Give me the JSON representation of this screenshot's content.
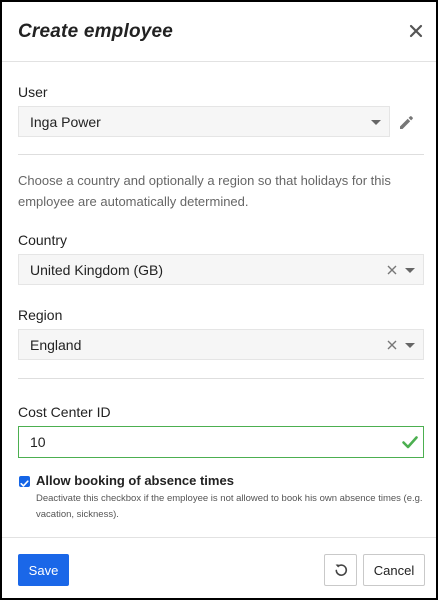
{
  "dialog": {
    "title": "Create employee",
    "close_icon": "close-icon"
  },
  "user": {
    "label": "User",
    "value": "Inga Power",
    "edit_icon": "pencil-icon"
  },
  "hint": "Choose a country and optionally a region so that holidays for this employee are automatically determined.",
  "country": {
    "label": "Country",
    "value": "United Kingdom (GB)"
  },
  "region": {
    "label": "Region",
    "value": "England"
  },
  "cost_center": {
    "label": "Cost Center ID",
    "value": "10",
    "valid_icon": "checkmark-icon"
  },
  "absence": {
    "checked": true,
    "label": "Allow booking of absence times",
    "help": "Deactivate this checkbox if the employee is not allowed to book his own absence times (e.g. vacation, sickness)."
  },
  "footer": {
    "save_label": "Save",
    "reset_icon": "undo-icon",
    "cancel_label": "Cancel"
  },
  "colors": {
    "primary": "#1a67e8",
    "valid": "#4caf50"
  }
}
